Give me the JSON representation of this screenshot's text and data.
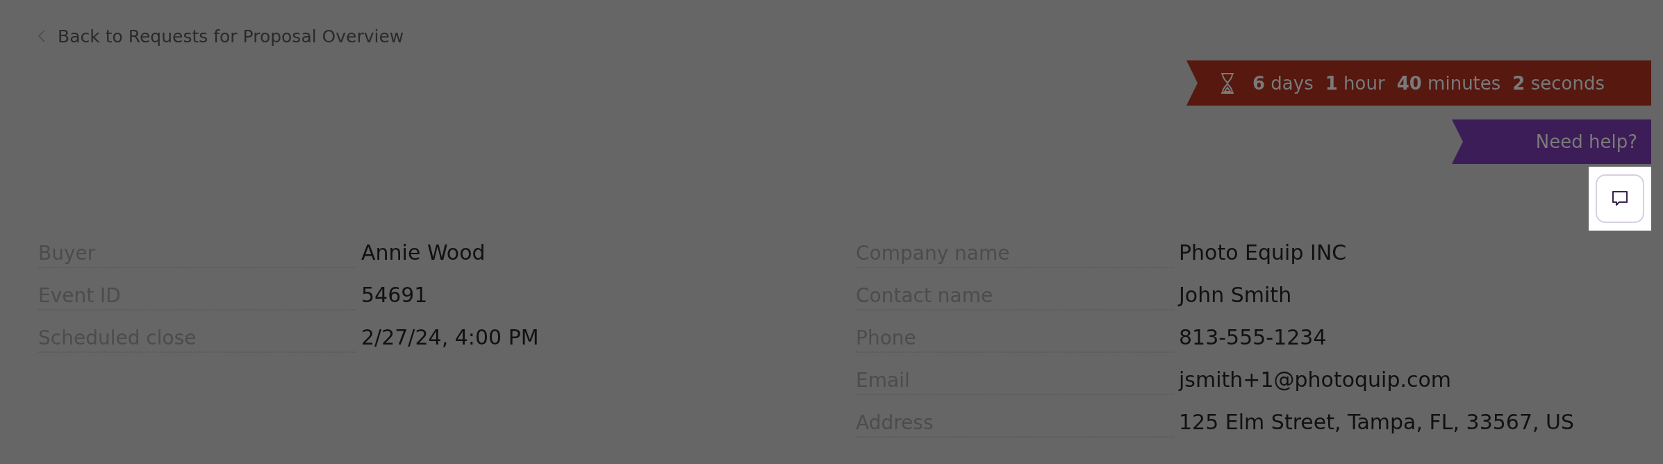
{
  "back_link": "Back to Requests for Proposal Overview",
  "countdown": [
    {
      "number": "6",
      "unit": "days"
    },
    {
      "number": "1",
      "unit": "hour"
    },
    {
      "number": "40",
      "unit": "minutes"
    },
    {
      "number": "2",
      "unit": "seconds"
    }
  ],
  "help_banner": "Need help?",
  "left_details": [
    {
      "label": "Buyer",
      "value": "Annie Wood"
    },
    {
      "label": "Event ID",
      "value": "54691"
    },
    {
      "label": "Scheduled close",
      "value": "2/27/24, 4:00 PM"
    }
  ],
  "right_details": [
    {
      "label": "Company name",
      "value": "Photo Equip INC"
    },
    {
      "label": "Contact name",
      "value": "John Smith"
    },
    {
      "label": "Phone",
      "value": "813-555-1234"
    },
    {
      "label": "Email",
      "value": "jsmith+1@photoquip.com"
    },
    {
      "label": "Address",
      "value": "125 Elm Street, Tampa, FL, 33567, US"
    }
  ]
}
